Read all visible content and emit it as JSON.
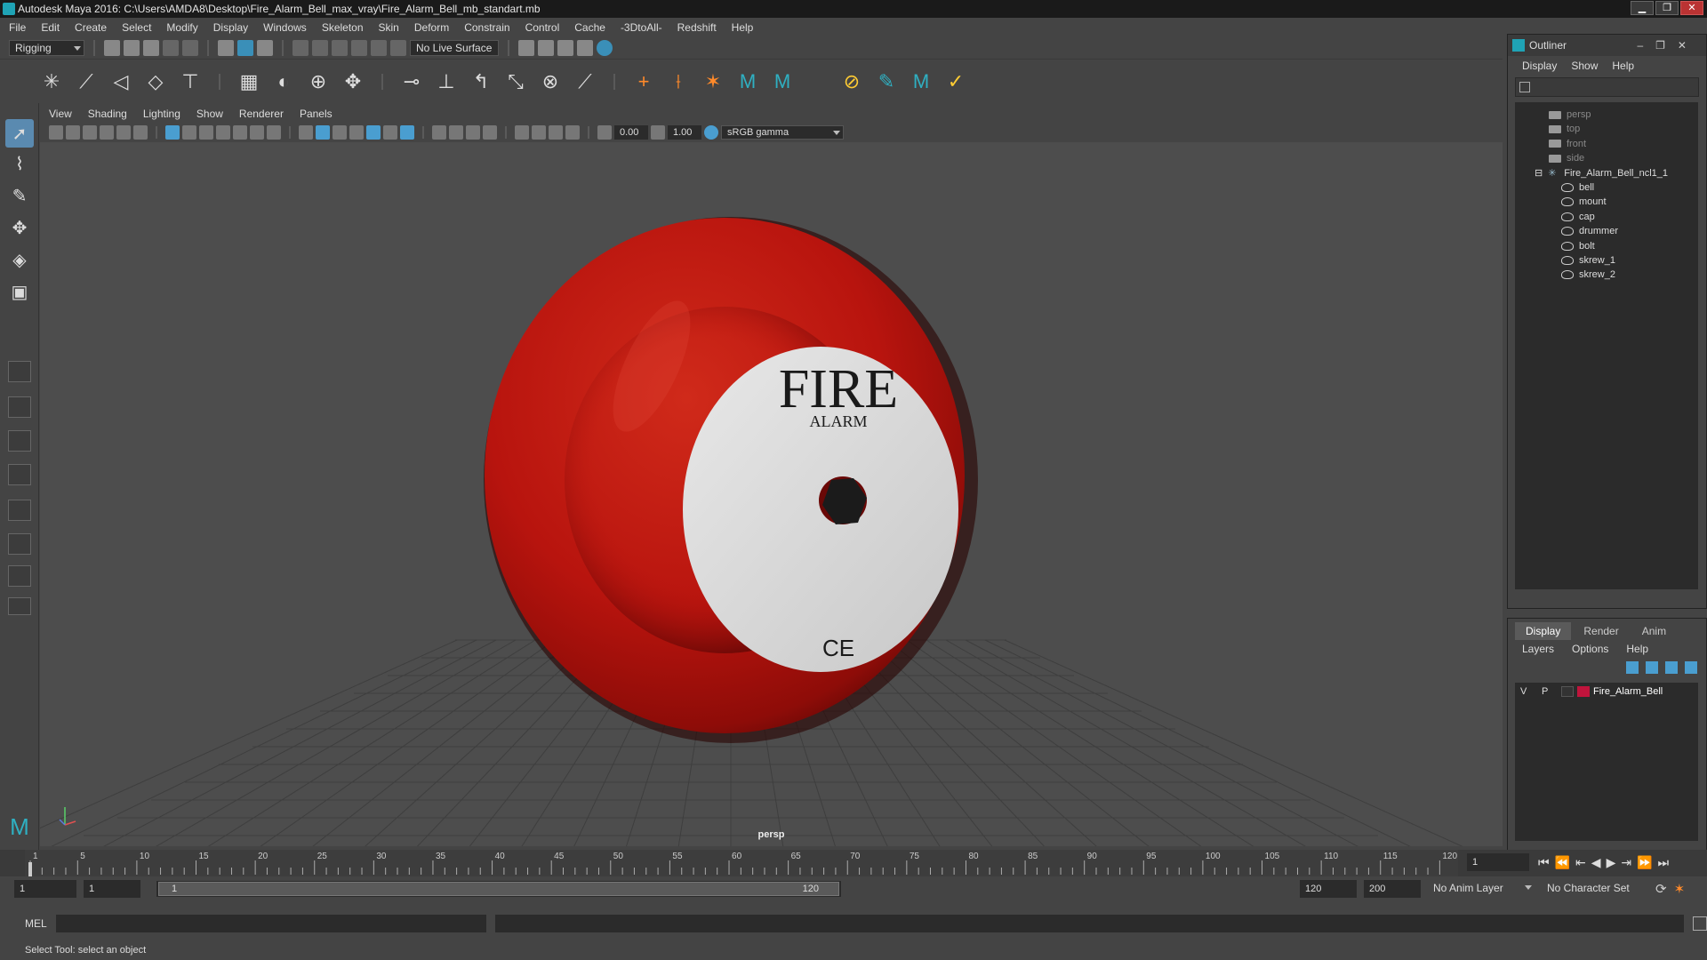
{
  "window": {
    "title": "Autodesk Maya 2016: C:\\Users\\AMDA8\\Desktop\\Fire_Alarm_Bell_max_vray\\Fire_Alarm_Bell_mb_standart.mb",
    "min": "▁",
    "max": "❐",
    "close": "✕"
  },
  "menubar": [
    "File",
    "Edit",
    "Create",
    "Select",
    "Modify",
    "Display",
    "Windows",
    "Skeleton",
    "Skin",
    "Deform",
    "Constrain",
    "Control",
    "Cache",
    "-3DtoAll-",
    "Redshift",
    "Help"
  ],
  "statusline": {
    "menuset": "Rigging",
    "live_surface": "No Live Surface"
  },
  "panel_menu": [
    "View",
    "Shading",
    "Lighting",
    "Show",
    "Renderer",
    "Panels"
  ],
  "panel_toolbar": {
    "exposure": "0.00",
    "gamma": "1.00",
    "color_space": "sRGB gamma"
  },
  "viewport": {
    "camera": "persp",
    "bell_text_main": "FIRE",
    "bell_text_sub": "ALARM",
    "ce_mark": "CE",
    "bell_color": "#b8140e"
  },
  "outliner": {
    "title": "Outliner",
    "menu": [
      "Display",
      "Show",
      "Help"
    ],
    "items": [
      {
        "label": "persp",
        "type": "camera"
      },
      {
        "label": "top",
        "type": "camera"
      },
      {
        "label": "front",
        "type": "camera"
      },
      {
        "label": "side",
        "type": "camera"
      },
      {
        "label": "Fire_Alarm_Bell_ncl1_1",
        "type": "group"
      },
      {
        "label": "bell",
        "type": "mesh"
      },
      {
        "label": "mount",
        "type": "mesh"
      },
      {
        "label": "cap",
        "type": "mesh"
      },
      {
        "label": "drummer",
        "type": "mesh"
      },
      {
        "label": "bolt",
        "type": "mesh"
      },
      {
        "label": "skrew_1",
        "type": "mesh"
      },
      {
        "label": "skrew_2",
        "type": "mesh"
      }
    ]
  },
  "layer_editor": {
    "tabs": [
      "Display",
      "Render",
      "Anim"
    ],
    "menu": [
      "Layers",
      "Options",
      "Help"
    ],
    "layer": {
      "v": "V",
      "p": "P",
      "name": "Fire_Alarm_Bell",
      "color": "#c0143c"
    }
  },
  "timeline": {
    "ticks": [
      "1",
      "5",
      "10",
      "15",
      "20",
      "25",
      "30",
      "35",
      "40",
      "45",
      "50",
      "55",
      "60",
      "65",
      "70",
      "75",
      "80",
      "85",
      "90",
      "95",
      "100",
      "105",
      "110",
      "115",
      "120"
    ],
    "current_frame": "1"
  },
  "range": {
    "start": "1",
    "anim_start": "1",
    "range_start": "1",
    "range_end": "120",
    "anim_end": "120",
    "end": "200",
    "anim_layer": "No Anim Layer",
    "char_set": "No Character Set"
  },
  "cmdline": {
    "lang": "MEL"
  },
  "helpline": {
    "text": "Select Tool: select an object"
  }
}
